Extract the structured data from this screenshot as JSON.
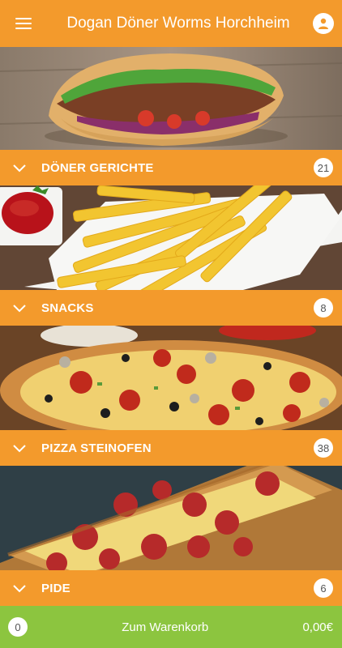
{
  "header": {
    "title": "Dogan Döner Worms Horchheim",
    "menu_icon": "hamburger-menu-icon",
    "account_icon": "user-account-icon"
  },
  "colors": {
    "accent": "#f39a2c",
    "cart_bar": "#8cc53f",
    "text_on_accent": "#ffffff"
  },
  "categories": [
    {
      "label": "DÖNER GERICHTE",
      "count": "21",
      "image": "doner-sandwich"
    },
    {
      "label": "SNACKS",
      "count": "8",
      "image": "french-fries"
    },
    {
      "label": "PIZZA STEINOFEN",
      "count": "38",
      "image": "stone-oven-pizza"
    },
    {
      "label": "PIDE",
      "count": "6",
      "image": "pepperoni-pide"
    }
  ],
  "cart": {
    "count": "0",
    "label": "Zum Warenkorb",
    "total": "0,00€"
  }
}
